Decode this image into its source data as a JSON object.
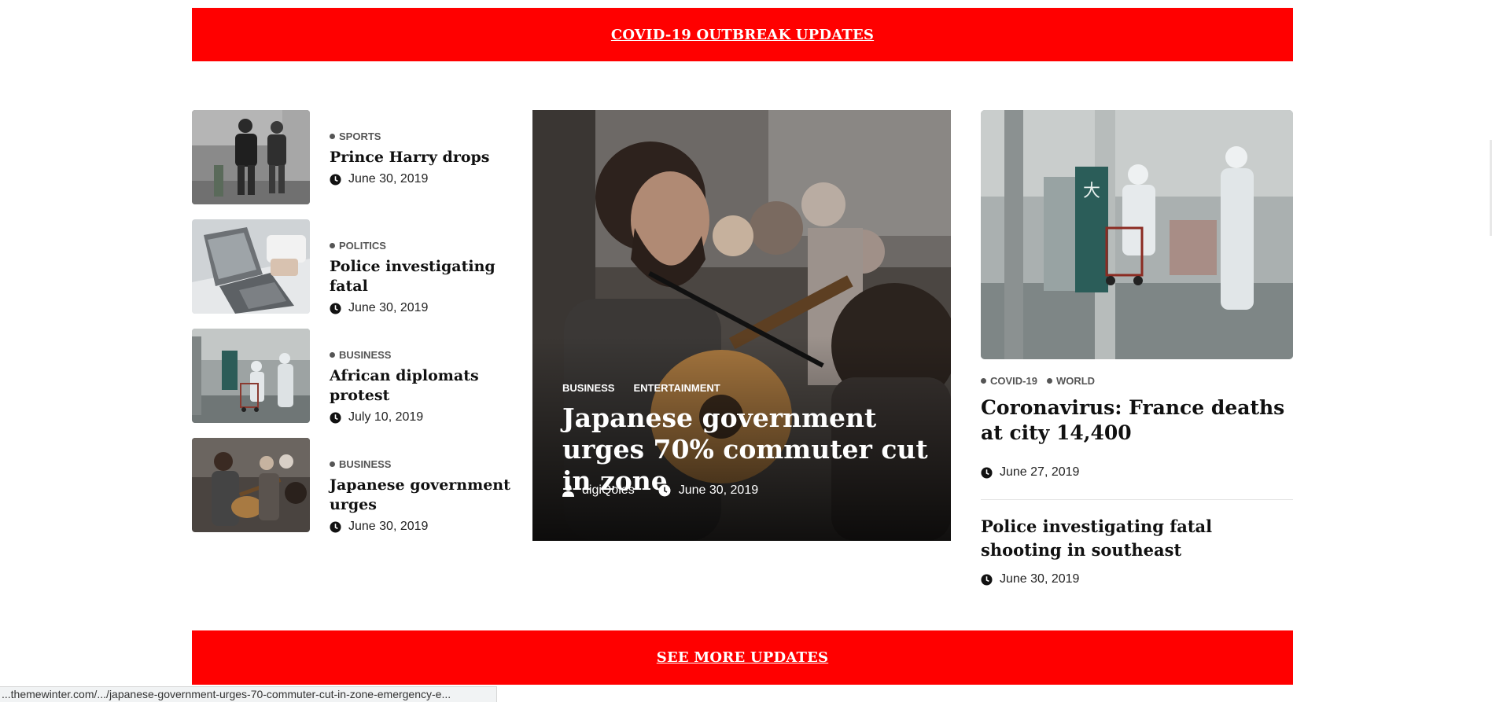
{
  "banner_top": {
    "label": "COVID-19 OUTBREAK UPDATES"
  },
  "banner_bottom": {
    "label": "SEE MORE UPDATES"
  },
  "left_list": [
    {
      "category": "SPORTS",
      "title": "Prince Harry drops",
      "date": "June 30, 2019"
    },
    {
      "category": "POLITICS",
      "title": "Police investigating fatal",
      "date": "June 30, 2019"
    },
    {
      "category": "BUSINESS",
      "title": "African diplomats protest",
      "date": "July 10, 2019"
    },
    {
      "category": "BUSINESS",
      "title": "Japanese government urges",
      "date": "June 30, 2019"
    }
  ],
  "featured": {
    "categories": [
      "BUSINESS",
      "ENTERTAINMENT"
    ],
    "title": "Japanese government urges 70% commuter cut in zone",
    "author": "digiQoles",
    "date": "June 30, 2019"
  },
  "right": {
    "categories": [
      "COVID-19",
      "WORLD"
    ],
    "title1": "Coronavirus: France deaths at city 14,400",
    "date1": "June 27, 2019",
    "title2": "Police investigating fatal shooting in southeast",
    "date2": "June 30, 2019",
    "image_sign": "大"
  },
  "status_bar": {
    "url": "...themewinter.com/.../japanese-government-urges-70-commuter-cut-in-zone-emergency-e..."
  },
  "icons": {
    "clock": "clock-icon",
    "user": "user-icon"
  },
  "colors": {
    "accent": "#ff0000"
  }
}
